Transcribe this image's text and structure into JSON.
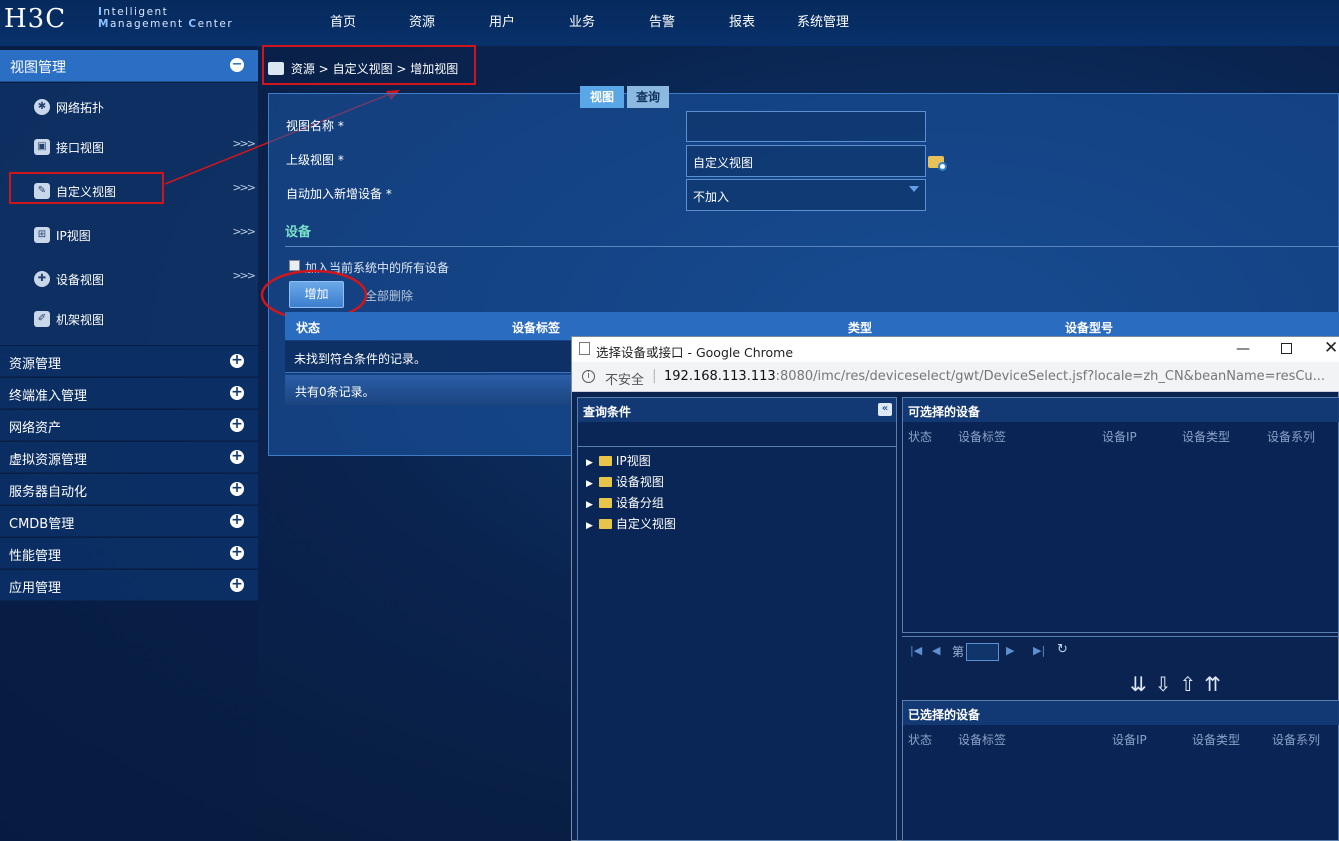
{
  "header": {
    "logo": "H3C",
    "logo_line1": "ntelligent",
    "logo_line1_initial": "I",
    "logo_line2": "anagement",
    "logo_line2_initial": "M",
    "logo_line2_end": "enter",
    "logo_line2_end_initial": "C",
    "nav": [
      "首页",
      "资源",
      "用户",
      "业务",
      "告警",
      "报表",
      "系统管理"
    ]
  },
  "sidebar": {
    "view_section": "视图管理",
    "view_items": [
      {
        "label": "网络拓扑",
        "icon": "network-topology-icon"
      },
      {
        "label": "接口视图",
        "icon": "interface-icon",
        "arrow": ">>>"
      },
      {
        "label": "自定义视图",
        "icon": "custom-view-icon",
        "arrow": ">>>"
      },
      {
        "label": "IP视图",
        "icon": "ip-view-icon",
        "arrow": ">>>"
      },
      {
        "label": "设备视图",
        "icon": "device-view-icon",
        "arrow": ">>>"
      },
      {
        "label": "机架视图",
        "icon": "rack-icon"
      }
    ],
    "categories": [
      "资源管理",
      "终端准入管理",
      "网络资产",
      "虚拟资源管理",
      "服务器自动化",
      "CMDB管理",
      "性能管理",
      "应用管理"
    ]
  },
  "breadcrumb": {
    "items": [
      "资源",
      "自定义视图",
      "增加视图"
    ],
    "sep": ">"
  },
  "form": {
    "name_label": "视图名称 *",
    "name_value": "",
    "parent_label": "上级视图 *",
    "parent_value": "自定义视图",
    "auto_label": "自动加入新增设备 *",
    "auto_value": "不加入",
    "device_section": "设备",
    "add_all_checkbox": "加入当前系统中的所有设备",
    "add_button": "增加",
    "delete_all_button": "全部删除",
    "table_headers": [
      "状态",
      "设备标签",
      "类型",
      "设备型号"
    ],
    "empty_text": "未找到符合条件的记录。",
    "total_text": "共有0条记录。"
  },
  "dialog": {
    "title": "选择设备或接口 - Google Chrome",
    "insecure": "不安全",
    "url_host": "192.168.113.113",
    "url_rest": ":8080/imc/res/deviceselect/gwt/DeviceSelect.jsf?locale=zh_CN&beanName=resCu...",
    "query_title": "查询条件",
    "tabs": [
      "视图",
      "查询"
    ],
    "tree": [
      "IP视图",
      "设备视图",
      "设备分组",
      "自定义视图"
    ],
    "available_title": "可选择的设备",
    "available_cols": [
      "状态",
      "设备标签",
      "设备IP",
      "设备类型",
      "设备系列"
    ],
    "selected_title": "已选择的设备",
    "selected_cols": [
      "状态",
      "设备标签",
      "设备IP",
      "设备类型",
      "设备系列"
    ],
    "page_prefix": "第"
  }
}
